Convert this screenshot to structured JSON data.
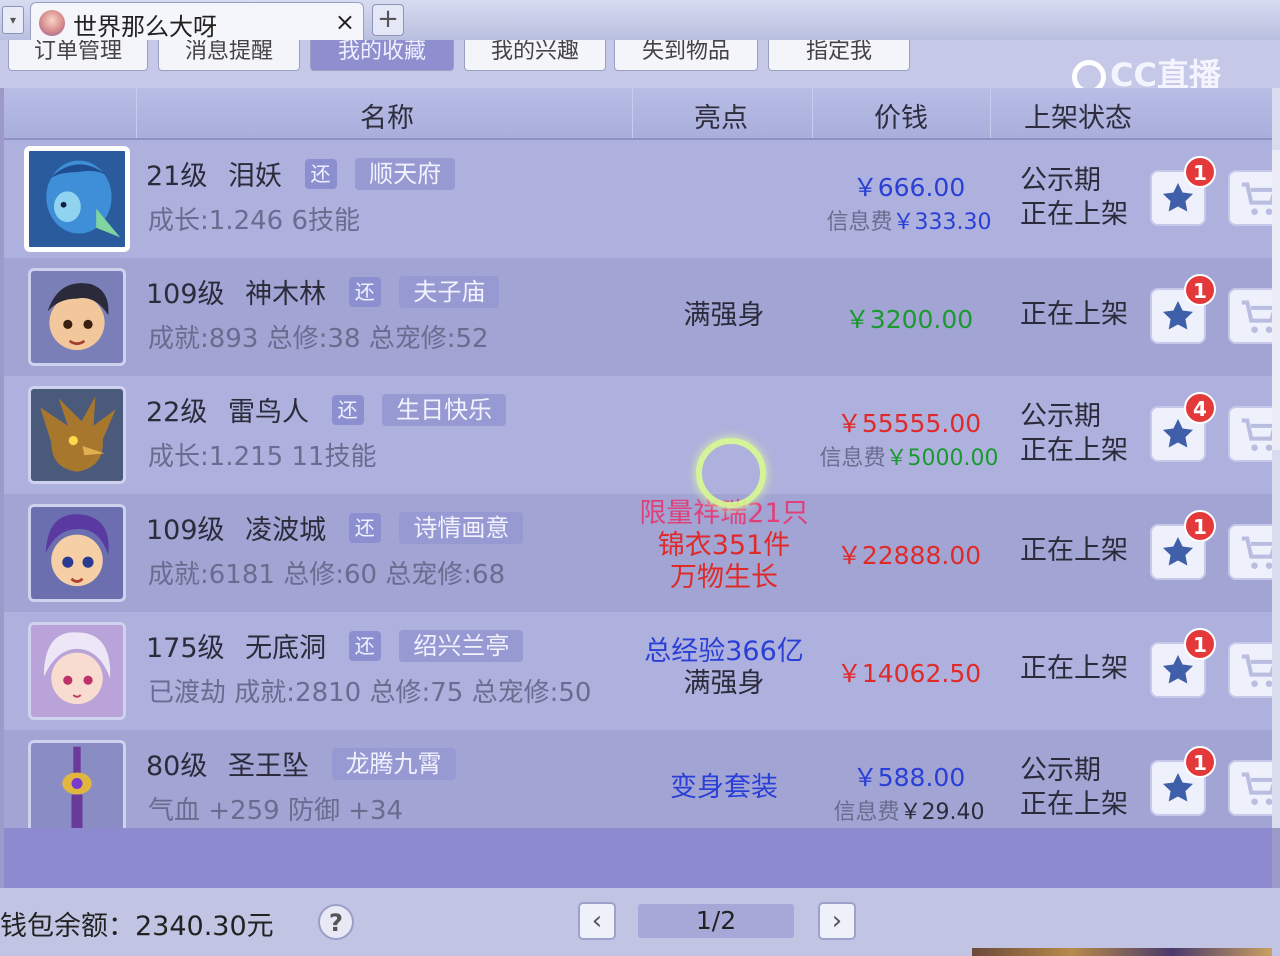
{
  "window": {
    "tab_title": "世界那么大呀",
    "close_glyph": "×",
    "add_glyph": "+",
    "dropdown_glyph": "▾"
  },
  "subnav": {
    "items": [
      "订单管理",
      "消息提醒",
      "我的收藏",
      "我的兴趣",
      "失到物品",
      "指定我"
    ],
    "active_index": 2
  },
  "overlay_logo": "CC直播",
  "table": {
    "headers": {
      "name": "名称",
      "highlight": "亮点",
      "price": "价钱",
      "status": "上架状态"
    }
  },
  "rows": [
    {
      "level": "21级",
      "name": "泪妖",
      "huan": "还",
      "server": "顺天府",
      "details": "成长:1.246  6技能",
      "highlight": [],
      "price": "￥666.00",
      "price_color": "#2a3fd6",
      "fee": "信息费￥333.30",
      "fee_amount_color": "#2a3fd6",
      "status": [
        "公示期",
        "正在上架"
      ],
      "fav_count": "1",
      "avatar": "water-demon-avatar",
      "selected": true
    },
    {
      "level": "109级",
      "name": "神木林",
      "huan": "还",
      "server": "夫子庙",
      "details": "成就:893  总修:38  总宠修:52",
      "highlight": [
        {
          "text": "满强身",
          "color": "#2b2b3b"
        }
      ],
      "price": "￥3200.00",
      "price_color": "#1a9a2e",
      "fee": "",
      "status": [
        "正在上架"
      ],
      "fav_count": "1",
      "avatar": "boy-hero-avatar",
      "selected": false
    },
    {
      "level": "22级",
      "name": "雷鸟人",
      "huan": "还",
      "server": "生日快乐",
      "details": "成长:1.215  11技能",
      "highlight": [],
      "price": "￥55555.00",
      "price_color": "#e02a2a",
      "fee": "信息费￥5000.00",
      "fee_amount_color": "#1a9a2e",
      "status": [
        "公示期",
        "正在上架"
      ],
      "fav_count": "4",
      "avatar": "thunderbird-avatar",
      "selected": false
    },
    {
      "level": "109级",
      "name": "凌波城",
      "huan": "还",
      "server": "诗情画意",
      "details": "成就:6181  总修:60  总宠修:68",
      "highlight": [
        {
          "text": "限量祥瑞21只",
          "color": "#e0407a"
        },
        {
          "text": "锦衣351件",
          "color": "#e02a2a"
        },
        {
          "text": "万物生长",
          "color": "#e02a2a"
        }
      ],
      "price": "￥22888.00",
      "price_color": "#e02a2a",
      "fee": "",
      "status": [
        "正在上架"
      ],
      "fav_count": "1",
      "avatar": "purple-hair-hero-avatar",
      "selected": false
    },
    {
      "level": "175级",
      "name": "无底洞",
      "huan": "还",
      "server": "绍兴兰亭",
      "details": "已渡劫  成就:2810  总修:75  总宠修:50",
      "highlight": [
        {
          "text": "总经验366亿",
          "color": "#2a3fd6"
        },
        {
          "text": "满强身",
          "color": "#2b2b3b"
        }
      ],
      "price": "￥14062.50",
      "price_color": "#e02a2a",
      "fee": "",
      "status": [
        "正在上架"
      ],
      "fav_count": "1",
      "avatar": "white-hair-girl-avatar",
      "selected": false
    },
    {
      "level": "80级",
      "name": "圣王坠",
      "huan": "",
      "server": "龙腾九霄",
      "details": "气血 +259  防御 +34",
      "highlight": [
        {
          "text": "变身套装",
          "color": "#2a3fd6"
        }
      ],
      "price": "￥588.00",
      "price_color": "#2a3fd6",
      "fee": "信息费￥29.40",
      "fee_amount_color": "#2b2b3b",
      "status": [
        "公示期",
        "正在上架"
      ],
      "fav_count": "1",
      "avatar": "pendant-item-avatar",
      "selected": false
    }
  ],
  "footer": {
    "wallet": "钱包余额：2340.30元",
    "help": "?",
    "prev": "‹",
    "next": "›",
    "page": "1/2"
  }
}
